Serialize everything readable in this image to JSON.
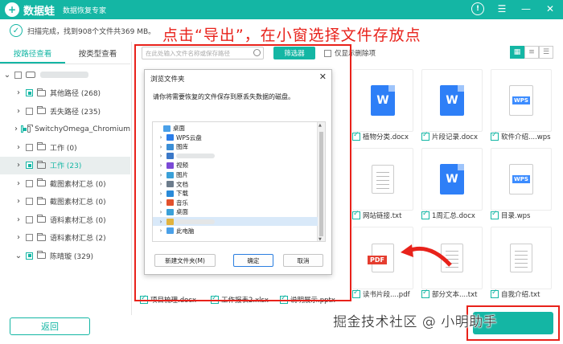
{
  "titlebar": {
    "logo": "+",
    "app_name": "数据蛙",
    "subtitle": "数据恢复专家"
  },
  "status": {
    "text": "扫描完成，找到908个文件共369 MB。"
  },
  "instruction": "点击“导出”，在小窗选择文件存放点",
  "left_tabs": [
    "按路径查看",
    "按类型查看"
  ],
  "tree": [
    {
      "label": "",
      "blurred": true,
      "expanded": true,
      "indent": 0,
      "icon": "drive"
    },
    {
      "label": "其他路径 (268)",
      "indent": 1,
      "partial": true
    },
    {
      "label": "丢失路径 (235)",
      "indent": 1,
      "partial": false
    },
    {
      "label": "SwitchyOmega_Chromium",
      "indent": 1,
      "partial": true
    },
    {
      "label": "工作 (0)",
      "indent": 1,
      "partial": false
    },
    {
      "label": "工作 (23)",
      "indent": 1,
      "partial": true,
      "selected": true
    },
    {
      "label": "截图素材汇总 (0)",
      "indent": 1,
      "partial": false
    },
    {
      "label": "截图素材汇总 (0)",
      "indent": 1,
      "partial": false
    },
    {
      "label": "语料素材汇总 (0)",
      "indent": 1,
      "partial": false
    },
    {
      "label": "语料素材汇总 (2)",
      "indent": 1,
      "partial": false
    },
    {
      "label": "陈晴璇 (329)",
      "indent": 1,
      "partial": true,
      "expanded": true
    }
  ],
  "search": {
    "placeholder": "在此处输入文件名称或保存路径"
  },
  "filter_label": "筛选器",
  "only_deleted_label": "仅显示删除项",
  "files": [
    {
      "name": "植物分类.docx",
      "type": "doc"
    },
    {
      "name": "片段记录.docx",
      "type": "doc"
    },
    {
      "name": "软件介绍....wps",
      "type": "wps"
    },
    {
      "name": "网站链接.txt",
      "type": "txt"
    },
    {
      "name": "1周汇总.docx",
      "type": "doc"
    },
    {
      "name": "目录.wps",
      "type": "wps"
    },
    {
      "name": "读书片段....pdf",
      "type": "pdf"
    },
    {
      "name": "部分文本....txt",
      "type": "txt"
    },
    {
      "name": "自我介绍.txt",
      "type": "txt"
    }
  ],
  "bottom_row_partial": [
    "项目梳理.docx",
    "工作报表2.xlsx",
    "说明展示.pptx"
  ],
  "back_label": "返回",
  "watermark": "掘金技术社区 @ 小明助手",
  "dialog": {
    "title": "浏览文件夹",
    "close": "✕",
    "description": "请你将需要恢复的文件保存到原丢失数据的磁盘。",
    "items": [
      {
        "label": "桌面",
        "chev": "",
        "color": "#4aa0e8",
        "indent": 0
      },
      {
        "label": "WPS云盘",
        "chev": "›",
        "color": "#2b7de9",
        "indent": 1
      },
      {
        "label": "图库",
        "chev": "›",
        "color": "#3b8ed6",
        "indent": 1
      },
      {
        "label": "",
        "chev": "›",
        "color": "#3b78c8",
        "indent": 1,
        "blurred": true
      },
      {
        "label": "视频",
        "chev": "›",
        "color": "#7b4ad6",
        "indent": 1
      },
      {
        "label": "图片",
        "chev": "›",
        "color": "#3aa0d8",
        "indent": 1
      },
      {
        "label": "文档",
        "chev": "›",
        "color": "#6c7c8c",
        "indent": 1
      },
      {
        "label": "下载",
        "chev": "›",
        "color": "#2a8ad8",
        "indent": 1
      },
      {
        "label": "音乐",
        "chev": "›",
        "color": "#e2512d",
        "indent": 1
      },
      {
        "label": "桌面",
        "chev": "›",
        "color": "#3aa0d8",
        "indent": 1
      },
      {
        "label": "",
        "chev": "›",
        "color": "#e2b33d",
        "indent": 1,
        "blurred": true,
        "selected": true
      },
      {
        "label": "此电脑",
        "chev": "›",
        "color": "#4aa0e8",
        "indent": 1
      }
    ],
    "new_folder": "新建文件夹(M)",
    "ok": "确定",
    "cancel": "取消"
  },
  "colors": {
    "accent": "#14b6a4",
    "highlight": "#e8221b"
  }
}
